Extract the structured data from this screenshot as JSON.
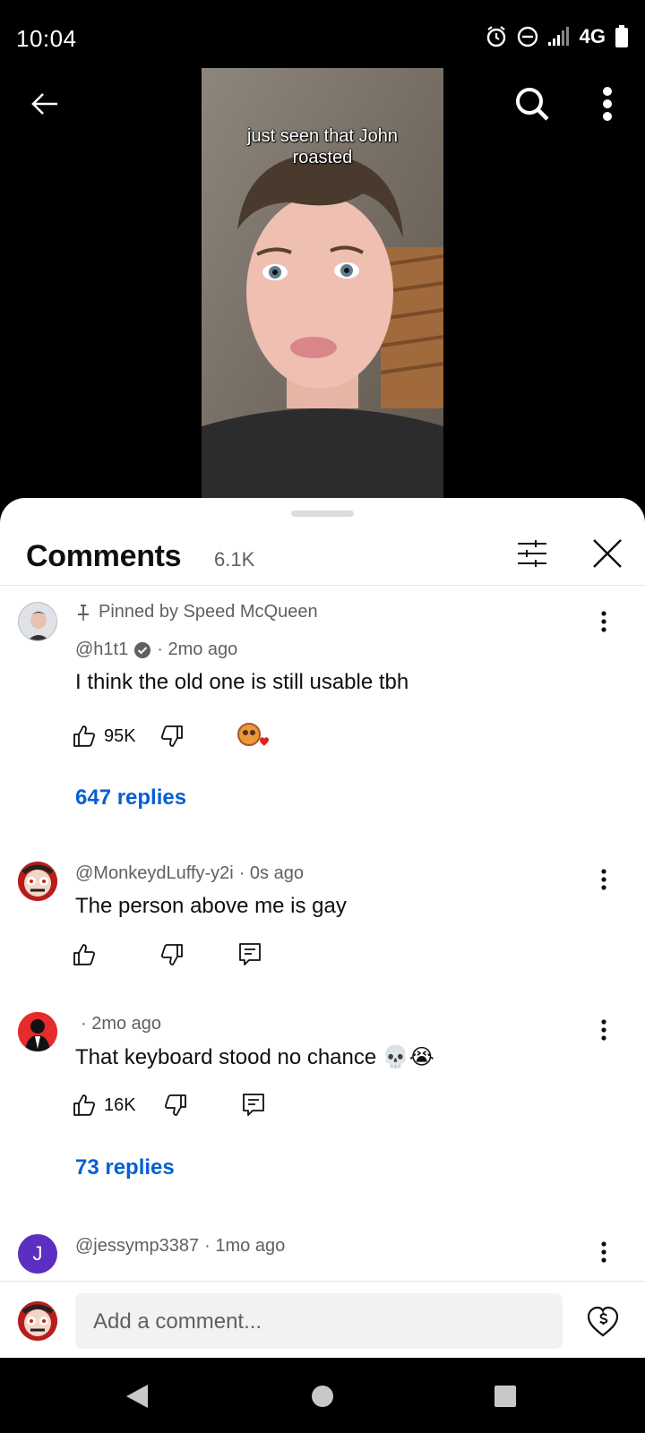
{
  "status_bar": {
    "time": "10:04",
    "network": "4G"
  },
  "video": {
    "caption_line1": "just seen that John",
    "caption_line2": "roasted"
  },
  "comments_panel": {
    "title": "Comments",
    "count": "6.1K",
    "comments": [
      {
        "pinned_label": "Pinned by Speed McQueen",
        "author": "@h1t1",
        "time": "· 2mo ago",
        "text": "I think the old one is still usable tbh",
        "likes": "95K",
        "replies": "647 replies"
      },
      {
        "author": "@MonkeydLuffy-y2i",
        "time": "· 0s ago",
        "text": "The person above me is gay"
      },
      {
        "author": "",
        "time": "· 2mo ago",
        "text": "That keyboard stood no chance 💀😭",
        "likes": "16K",
        "replies": "73 replies"
      },
      {
        "author": "@jessymp3387",
        "time": "· 1mo ago",
        "avatar_letter": "J"
      }
    ]
  },
  "composer": {
    "placeholder": "Add a comment..."
  },
  "colors": {
    "link": "#065fd4",
    "secondary_text": "#606060",
    "heart": "#e02020"
  }
}
